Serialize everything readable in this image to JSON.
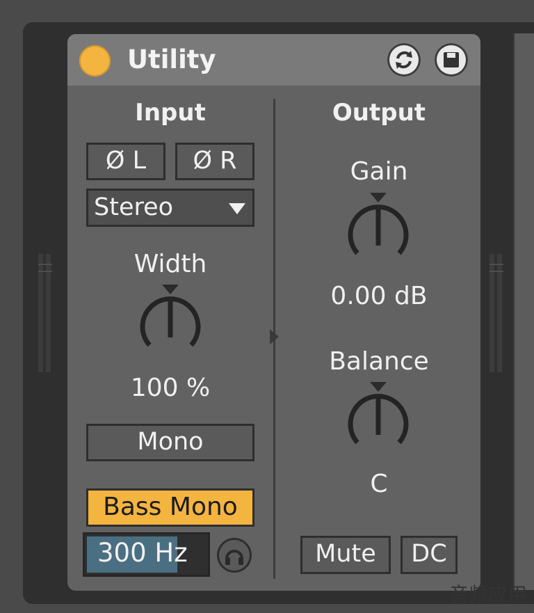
{
  "device": {
    "title": "Utility",
    "power_on": true
  },
  "input": {
    "heading": "Input",
    "phase_left_label": "Ø L",
    "phase_right_label": "Ø R",
    "channel_mode": "Stereo",
    "width_label": "Width",
    "width_value": "100 %",
    "mono_label": "Mono",
    "bass_mono_label": "Bass Mono",
    "bass_mono_freq": "300 Hz"
  },
  "output": {
    "heading": "Output",
    "gain_label": "Gain",
    "gain_value": "0.00 dB",
    "balance_label": "Balance",
    "balance_value": "C",
    "mute_label": "Mute",
    "dc_label": "DC"
  },
  "watermark": "音频应用",
  "colors": {
    "accent": "#f4b440",
    "panel": "#626262",
    "titlebar": "#7a7a7a",
    "freq_fill": "#4b6f82"
  },
  "icons": {
    "power": "power-led-icon",
    "hot_swap": "hot-swap-icon",
    "save": "save-icon",
    "headphone": "headphone-icon",
    "caret": "chevron-down-icon"
  }
}
